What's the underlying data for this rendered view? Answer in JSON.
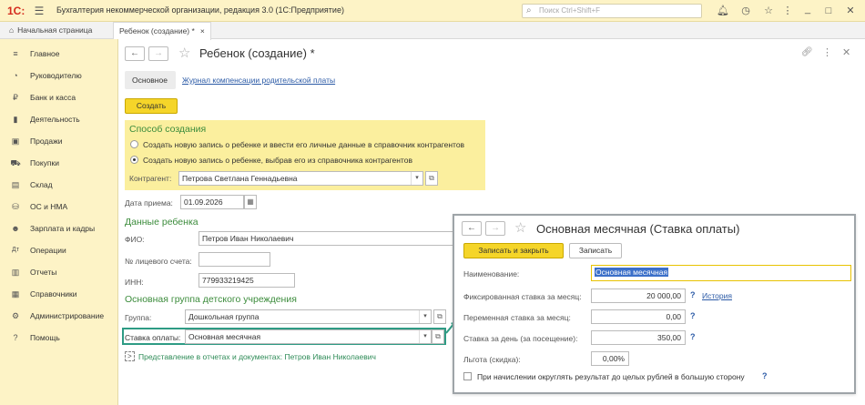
{
  "titlebar": {
    "logo": "1С:",
    "title": "Бухгалтерия некоммерческой организации, редакция 3.0  (1С:Предприятие)",
    "search_placeholder": "Поиск Ctrl+Shift+F"
  },
  "tabs": [
    {
      "label": "Начальная страница"
    },
    {
      "label": "Ребенок (создание) *"
    }
  ],
  "sidebar": {
    "items": [
      {
        "label": "Главное",
        "icon": "≡"
      },
      {
        "label": "Руководителю",
        "icon": "◔"
      },
      {
        "label": "Банк и касса",
        "icon": "₽"
      },
      {
        "label": "Деятельность",
        "icon": "▮"
      },
      {
        "label": "Продажи",
        "icon": "▣"
      },
      {
        "label": "Покупки",
        "icon": "⛟"
      },
      {
        "label": "Склад",
        "icon": "▤"
      },
      {
        "label": "ОС и НМА",
        "icon": "⛁"
      },
      {
        "label": "Зарплата и кадры",
        "icon": "☻"
      },
      {
        "label": "Операции",
        "icon": "Дт"
      },
      {
        "label": "Отчеты",
        "icon": "▥"
      },
      {
        "label": "Справочники",
        "icon": "▦"
      },
      {
        "label": "Администрирование",
        "icon": "⚙"
      },
      {
        "label": "Помощь",
        "icon": "?"
      }
    ]
  },
  "form": {
    "title": "Ребенок (создание) *",
    "tab_main": "Основное",
    "tab_journal": "Журнал компенсации родительской платы",
    "create_button": "Создать",
    "method_section": "Способ создания",
    "radio_new": "Создать новую запись о ребенке и ввести его личные данные в справочник контрагентов",
    "radio_existing": "Создать новую запись о ребенке, выбрав его из справочника контрагентов",
    "counterparty_label": "Контрагент:",
    "counterparty_value": "Петрова Светлана Геннадьевна",
    "admission_label": "Дата приема:",
    "admission_value": "01.09.2026",
    "child_section": "Данные ребенка",
    "fio_label": "ФИО:",
    "fio_value": "Петров Иван Николаевич",
    "account_label": "№ лицевого счета:",
    "account_value": "",
    "inn_label": "ИНН:",
    "inn_value": "779933219425",
    "group_section": "Основная группа детского учреждения",
    "group_label": "Группа:",
    "group_value": "Дошкольная группа",
    "rate_label": "Ставка оплаты:",
    "rate_value": "Основная месячная",
    "representation": "Представление в отчетах и документах: Петров Иван Николаевич"
  },
  "popup": {
    "title": "Основная месячная (Ставка оплаты)",
    "save_close": "Записать и закрыть",
    "save": "Записать",
    "name_label": "Наименование:",
    "name_value": "Основная месячная",
    "fixed_label": "Фиксированная ставка за месяц:",
    "fixed_value": "20 000,00",
    "history_link": "История",
    "variable_label": "Переменная ставка за месяц:",
    "variable_value": "0,00",
    "daily_label": "Ставка за день (за посещение):",
    "daily_value": "350,00",
    "discount_label": "Льгота (скидка):",
    "discount_value": "0,00%",
    "round_label": "При начислении округлять результат до целых рублей в большую сторону",
    "help": "?"
  },
  "colors": {
    "accent_yellow": "#f5d529",
    "sidebar_bg": "#fdf3c6",
    "section_green": "#3c8c3c",
    "highlight_green": "#2e9b84",
    "link_blue": "#2b5aa6"
  }
}
